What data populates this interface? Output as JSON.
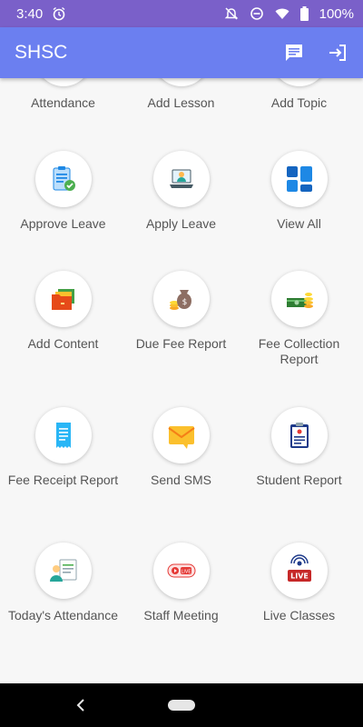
{
  "status_bar": {
    "time": "3:40",
    "battery": "100%"
  },
  "app_bar": {
    "title": "SHSC",
    "color": "#6b7ff0"
  },
  "tiles": [
    {
      "label": "Attendance",
      "icon": "calendar-icon"
    },
    {
      "label": "Add Lesson",
      "icon": "lesson-icon"
    },
    {
      "label": "Add Topic",
      "icon": "topic-icon"
    },
    {
      "label": "Approve Leave",
      "icon": "clipboard-check-icon"
    },
    {
      "label": "Apply Leave",
      "icon": "laptop-user-icon"
    },
    {
      "label": "View All",
      "icon": "grid-icon"
    },
    {
      "label": "Add Content",
      "icon": "folder-icon"
    },
    {
      "label": "Due Fee Report",
      "icon": "money-bag-icon"
    },
    {
      "label": "Fee Collection Report",
      "icon": "cash-stack-icon"
    },
    {
      "label": "Fee Receipt Report",
      "icon": "receipt-icon"
    },
    {
      "label": "Send SMS",
      "icon": "envelope-icon"
    },
    {
      "label": "Student Report",
      "icon": "report-clipboard-icon"
    },
    {
      "label": "Today's Attendance",
      "icon": "attendance-person-icon"
    },
    {
      "label": "Staff Meeting",
      "icon": "live-video-icon"
    },
    {
      "label": "Live Classes",
      "icon": "live-broadcast-icon"
    }
  ]
}
